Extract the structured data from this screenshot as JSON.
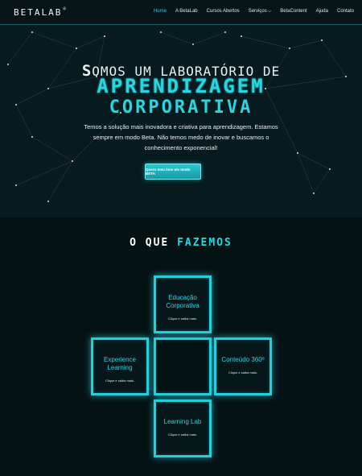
{
  "header": {
    "logo": "BETALAB",
    "logo_sup": "®",
    "nav": [
      "Home",
      "A BetaLab",
      "Cursos Abertos",
      "Serviços",
      "BetaContent",
      "Ajuda",
      "Contato"
    ]
  },
  "hero": {
    "line1_first": "S",
    "line1_rest": "OMOS UM LABORATÓRIO DE",
    "line2": "APRENDIZAGEM",
    "line3": "CORPORATIVA",
    "description": "Temos a solução mais inovadora e criativa para aprendizagem. Estamos sempre em modo Beta. Não temos medo de inovar e buscamos o conhecimento exponencial!",
    "cta": "Quero meu time em modo BETA"
  },
  "section": {
    "title_white": "O QUE",
    "title_cyan": "FAZEMOS"
  },
  "services": [
    {
      "title": "Educação Corporativa",
      "sub": "Clique e saiba mais."
    },
    {
      "title": "Experience Learning",
      "sub": "Clique e saiba mais."
    },
    {
      "title": "Conteúdo 360º",
      "sub": "Clique e saiba mais."
    },
    {
      "title": "Learning Lab",
      "sub": "Clique e saiba mais."
    }
  ],
  "colors": {
    "accent": "#27d6e1",
    "background": "#051214"
  }
}
